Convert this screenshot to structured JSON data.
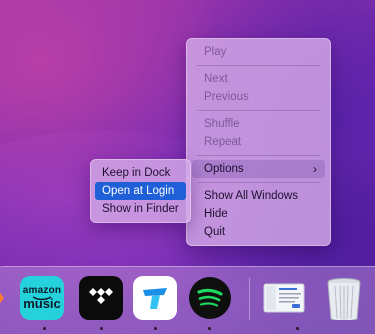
{
  "main_menu": {
    "items": [
      {
        "label": "Play",
        "enabled": false
      },
      {
        "label": "Next",
        "enabled": false
      },
      {
        "label": "Previous",
        "enabled": false
      },
      {
        "label": "Shuffle",
        "enabled": false
      },
      {
        "label": "Repeat",
        "enabled": false
      },
      {
        "label": "Options",
        "enabled": true,
        "submenu": true
      },
      {
        "label": "Show All Windows",
        "enabled": true
      },
      {
        "label": "Hide",
        "enabled": true
      },
      {
        "label": "Quit",
        "enabled": true
      }
    ]
  },
  "options_submenu": {
    "items": [
      {
        "label": "Keep in Dock",
        "selected": false
      },
      {
        "label": "Open at Login",
        "selected": true
      },
      {
        "label": "Show in Finder",
        "selected": false
      }
    ]
  },
  "dock": {
    "apps": [
      {
        "name": "Amazon Music",
        "icon_text_top": "amazon",
        "icon_text_bottom": "music",
        "running": true
      },
      {
        "name": "TIDAL",
        "running": true
      },
      {
        "name": "Topbar app",
        "running": true
      },
      {
        "name": "Spotify",
        "running": true
      },
      {
        "name": "Document preview",
        "running": true
      },
      {
        "name": "Trash",
        "running": false
      }
    ]
  },
  "colors": {
    "selection_blue": "#1f5fd8",
    "spotify_green": "#1ed760",
    "amazon_music_cyan": "#25d1da"
  }
}
